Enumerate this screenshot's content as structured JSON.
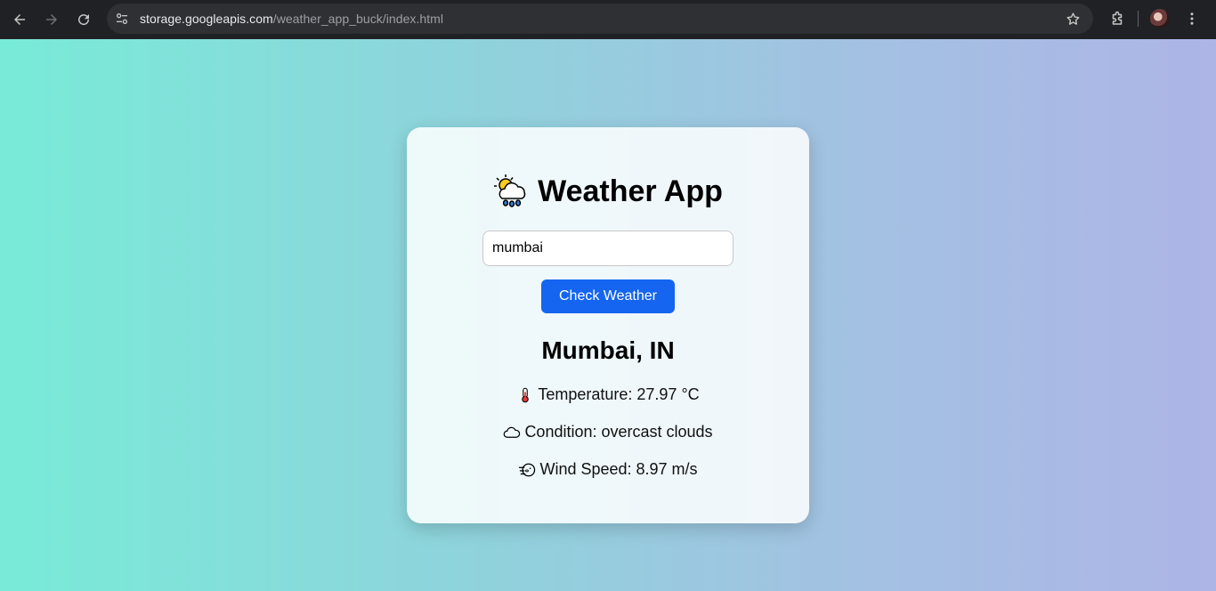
{
  "browser": {
    "url_host": "storage.googleapis.com",
    "url_path": "/weather_app_buck/index.html"
  },
  "app": {
    "title": "Weather App",
    "title_icon": "sun-behind-rain-cloud-icon",
    "search": {
      "value": "mumbai",
      "placeholder": ""
    },
    "button_label": "Check Weather",
    "location": "Mumbai, IN",
    "temperature": "Temperature: 27.97 °C",
    "condition": "Condition: overcast clouds",
    "wind": "Wind Speed: 8.97 m/s",
    "colors": {
      "button": "#1565f0",
      "gradient_start": "#78ebd8",
      "gradient_end": "#adb5e6"
    }
  }
}
